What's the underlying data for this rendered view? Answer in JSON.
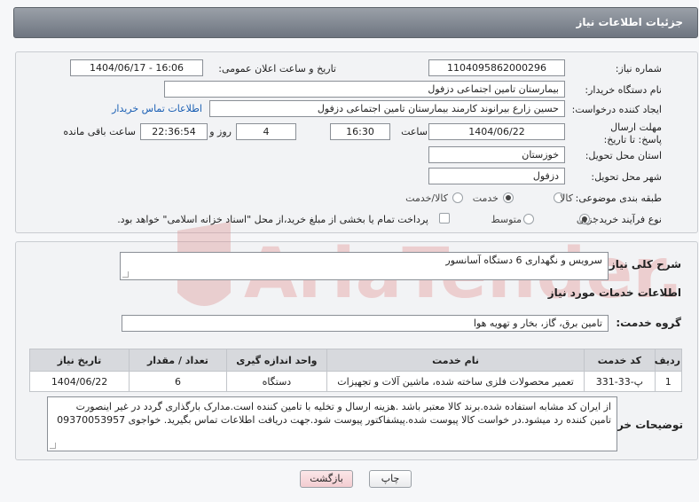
{
  "header": {
    "title": "جزئیات اطلاعات نیاز"
  },
  "form": {
    "need_number": {
      "label": "شماره نیاز:",
      "value": "1104095862000296"
    },
    "announce_datetime": {
      "label": "تاریخ و ساعت اعلان عمومی:",
      "value": "1404/06/17 - 16:06"
    },
    "buyer_org": {
      "label": "نام دستگاه خریدار:",
      "value": "بیمارستان تامین اجتماعی دزفول"
    },
    "requester": {
      "label": "ایجاد کننده درخواست:",
      "value": "حسین زارع بیرانوند کارمند بیمارستان تامین اجتماعی دزفول",
      "contact_link": "اطلاعات تماس خریدار"
    },
    "deadline": {
      "label": "مهلت ارسال پاسخ: تا تاریخ:",
      "date": "1404/06/22",
      "time_label": "ساعت",
      "time": "16:30",
      "days": "4",
      "days_label": "روز و",
      "remaining": "22:36:54",
      "remaining_label": "ساعت باقی مانده"
    },
    "province": {
      "label": "استان محل تحویل:",
      "value": "خوزستان"
    },
    "city": {
      "label": "شهر محل تحویل:",
      "value": "دزفول"
    },
    "category": {
      "label": "طبقه بندی موضوعی:",
      "options": [
        "کالا",
        "خدمت",
        "کالا/خدمت"
      ],
      "selected": "خدمت"
    },
    "purchase_type": {
      "label": "نوع فرآیند خرید :",
      "options": [
        "جزیی",
        "متوسط"
      ],
      "selected": "جزیی",
      "payment_note": "پرداخت تمام یا بخشی از مبلغ خرید،از محل \"اسناد خزانه اسلامی\" خواهد بود."
    }
  },
  "summary": {
    "label": "شرح کلی نیاز:",
    "value": "سرویس و نگهداری 6 دستگاه آسانسور"
  },
  "services": {
    "section_title": "اطلاعات خدمات مورد نیاز",
    "group_label": "گروه خدمت:",
    "group_value": "تامین برق، گاز، بخار و تهویه هوا",
    "table": {
      "headers": [
        "ردیف",
        "کد خدمت",
        "نام خدمت",
        "واحد اندازه گیری",
        "تعداد / مقدار",
        "تاریخ نیاز"
      ],
      "rows": [
        [
          "1",
          "پ-33-331",
          "تعمیر محصولات فلزی ساخته شده، ماشین آلات و تجهیزات",
          "دستگاه",
          "6",
          "1404/06/22"
        ]
      ]
    }
  },
  "buyer_notes": {
    "label": "توضیحات خریدار:",
    "value": "از ایران کد مشابه استفاده شده.برند کالا معتبر باشد .هزینه ارسال و تخلیه با تامین کننده است.مدارک بارگذاری گردد در غیر اینصورت تامین کننده رد میشود.در خواست کالا پیوست شده.پیشفاکتور پیوست شود.جهت دریافت اطلاعات تماس بگیرید. خواجوی 09370053957"
  },
  "buttons": {
    "print": "چاپ",
    "back": "بازگشت"
  },
  "watermark": {
    "text": "AriaTender.net"
  },
  "colors": {
    "header": "#7d848d",
    "link": "#1a5fb4",
    "back_button": "#f7d9dc",
    "watermark": "#e6a3a3"
  }
}
